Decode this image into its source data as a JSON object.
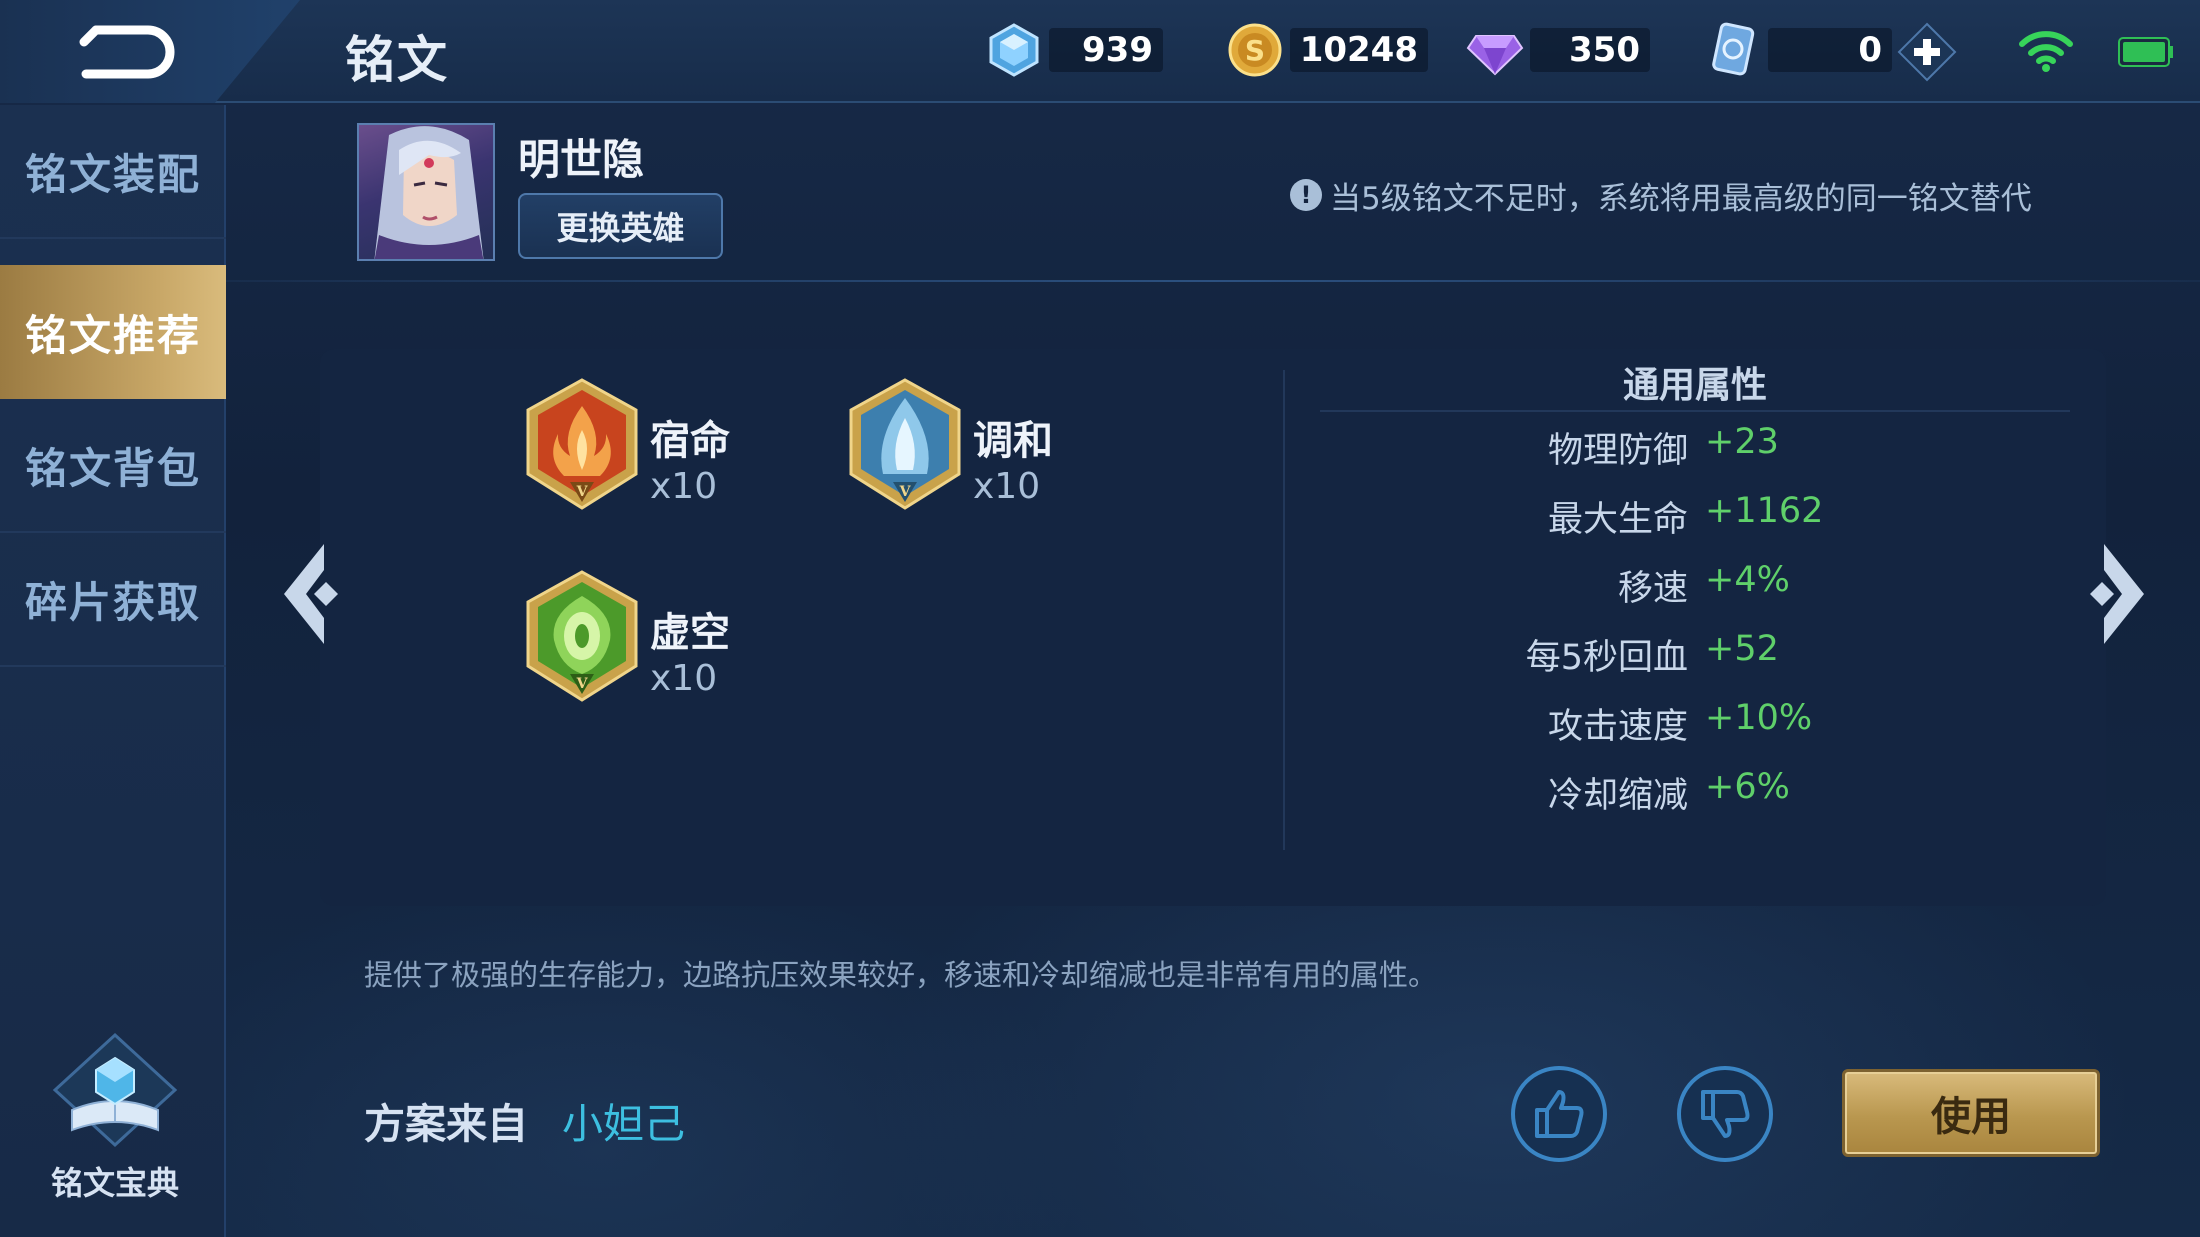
{
  "header": {
    "title": "铭文",
    "resources": [
      {
        "icon": "crystal-icon",
        "value": "939"
      },
      {
        "icon": "gold-coin-icon",
        "value": "10248"
      },
      {
        "icon": "diamond-icon",
        "value": "350"
      },
      {
        "icon": "voucher-icon",
        "value": "0"
      }
    ]
  },
  "sidebar": {
    "items": [
      {
        "label": "铭文装配",
        "active": false
      },
      {
        "label": "铭文推荐",
        "active": true
      },
      {
        "label": "铭文背包",
        "active": false
      },
      {
        "label": "碎片获取",
        "active": false
      }
    ],
    "codex_label": "铭文宝典"
  },
  "hero": {
    "name": "明世隐",
    "change_label": "更换英雄"
  },
  "notice": "当5级铭文不足时，系统将用最高级的同一铭文替代",
  "runes": [
    {
      "name": "宿命",
      "count": "x10",
      "icon": "red-rune-icon",
      "color": "#d9542b"
    },
    {
      "name": "调和",
      "count": "x10",
      "icon": "blue-rune-icon",
      "color": "#6fb7e0"
    },
    {
      "name": "虚空",
      "count": "x10",
      "icon": "green-rune-icon",
      "color": "#5fb83a"
    }
  ],
  "stats": {
    "title": "通用属性",
    "rows": [
      {
        "label": "物理防御",
        "value": "+23"
      },
      {
        "label": "最大生命",
        "value": "+1162"
      },
      {
        "label": "移速",
        "value": "+4%"
      },
      {
        "label": "每5秒回血",
        "value": "+52"
      },
      {
        "label": "攻击速度",
        "value": "+10%"
      },
      {
        "label": "冷却缩减",
        "value": "+6%"
      }
    ]
  },
  "description": "提供了极强的生存能力，边路抗压效果较好，移速和冷却缩减也是非常有用的属性。",
  "source": {
    "label": "方案来自",
    "author": "小妲己"
  },
  "actions": {
    "use_label": "使用"
  },
  "colors": {
    "accent_gold": "#c8a767",
    "stat_green": "#5fd06a",
    "author_cyan": "#3dbfe0"
  }
}
